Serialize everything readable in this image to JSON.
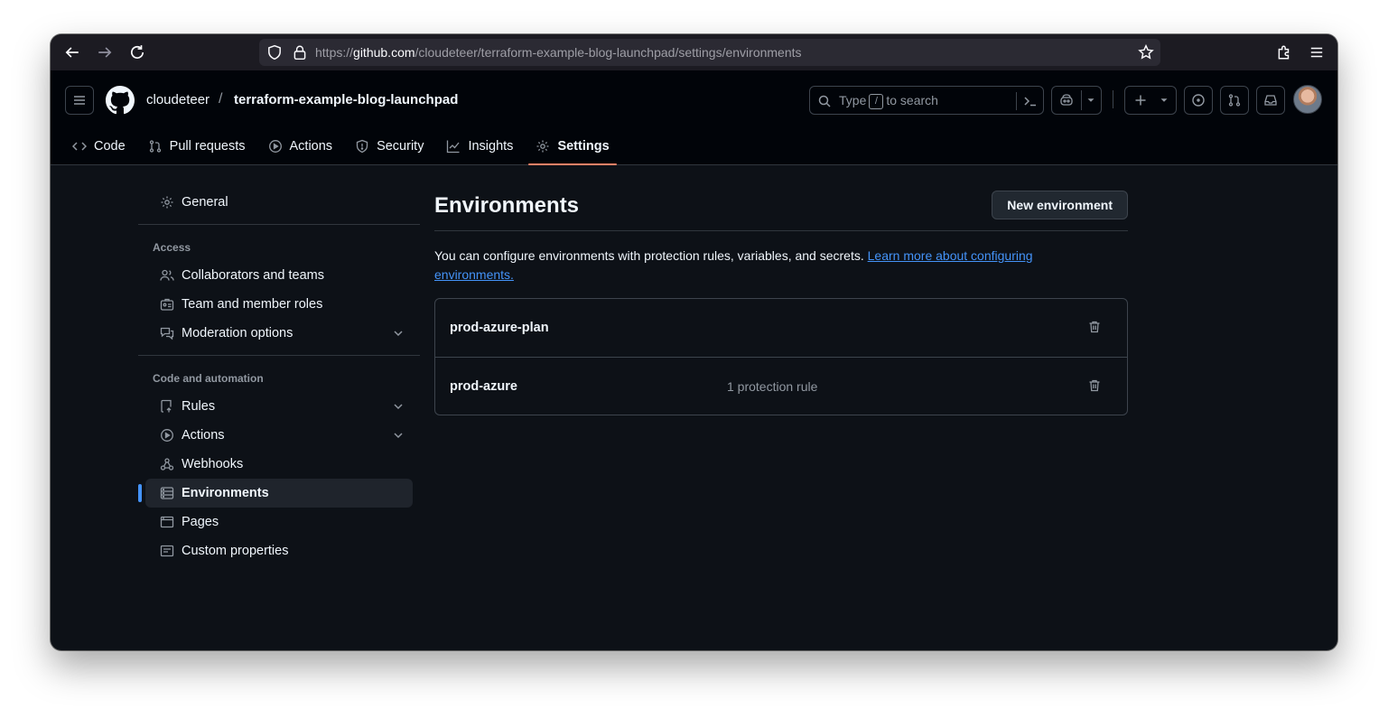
{
  "browser": {
    "url_prefix": "https://",
    "url_host": "github.com",
    "url_path": "/cloudeteer/terraform-example-blog-launchpad/settings/environments"
  },
  "header": {
    "owner": "cloudeteer",
    "separator": "/",
    "repo": "terraform-example-blog-launchpad",
    "search_before": "Type",
    "search_key": "/",
    "search_after": "to search"
  },
  "tabs": [
    {
      "label": "Code",
      "icon": "code-icon"
    },
    {
      "label": "Pull requests",
      "icon": "pull-request-icon"
    },
    {
      "label": "Actions",
      "icon": "play-icon"
    },
    {
      "label": "Security",
      "icon": "shield-icon"
    },
    {
      "label": "Insights",
      "icon": "graph-icon"
    },
    {
      "label": "Settings",
      "icon": "gear-icon",
      "selected": true
    }
  ],
  "sidebar": {
    "general": "General",
    "access_heading": "Access",
    "access_items": [
      {
        "label": "Collaborators and teams",
        "icon": "people-icon"
      },
      {
        "label": "Team and member roles",
        "icon": "id-badge-icon"
      },
      {
        "label": "Moderation options",
        "icon": "comment-discussion-icon",
        "expandable": true
      }
    ],
    "code_heading": "Code and automation",
    "code_items": [
      {
        "label": "Rules",
        "icon": "repo-push-icon",
        "expandable": true
      },
      {
        "label": "Actions",
        "icon": "play-icon",
        "expandable": true
      },
      {
        "label": "Webhooks",
        "icon": "webhook-icon"
      },
      {
        "label": "Environments",
        "icon": "server-icon",
        "active": true
      },
      {
        "label": "Pages",
        "icon": "browser-icon"
      },
      {
        "label": "Custom properties",
        "icon": "note-icon"
      }
    ]
  },
  "main": {
    "title": "Environments",
    "new_button": "New environment",
    "description": "You can configure environments with protection rules, variables, and secrets.",
    "learn_more": "Learn more about configuring environments.",
    "environments": [
      {
        "name": "prod-azure-plan",
        "rules": ""
      },
      {
        "name": "prod-azure",
        "rules": "1 protection rule"
      }
    ]
  },
  "colors": {
    "background": "#0d1117",
    "header": "#010409",
    "accent_tab": "#f78166",
    "link": "#4493f8",
    "active_indicator": "#4493f8"
  }
}
